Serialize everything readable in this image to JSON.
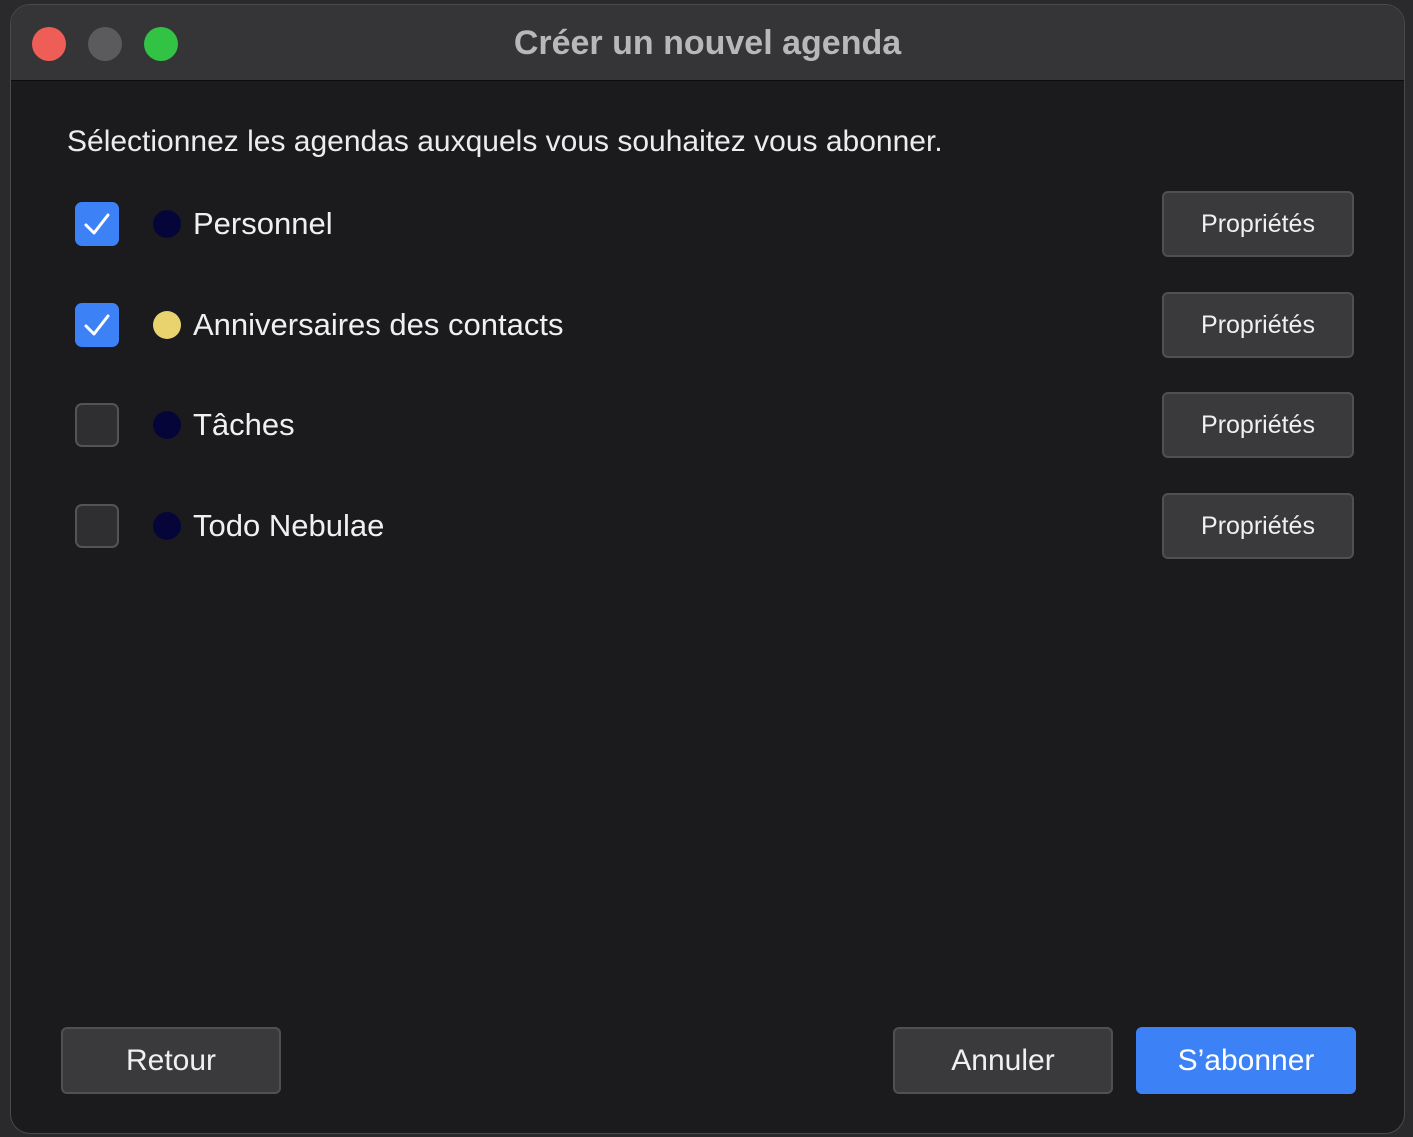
{
  "window": {
    "title": "Créer un nouvel agenda"
  },
  "instruction": "Sélectionnez les agendas auxquels vous souhaitez vous abonner.",
  "calendars": [
    {
      "name": "Personnel",
      "checked": true,
      "color": "#05053a",
      "properties_label": "Propriétés"
    },
    {
      "name": "Anniversaires des contacts",
      "checked": true,
      "color": "#e8d36e",
      "properties_label": "Propriétés"
    },
    {
      "name": "Tâches",
      "checked": false,
      "color": "#05053a",
      "properties_label": "Propriétés"
    },
    {
      "name": "Todo Nebulae",
      "checked": false,
      "color": "#05053a",
      "properties_label": "Propriétés"
    }
  ],
  "footer": {
    "back_label": "Retour",
    "cancel_label": "Annuler",
    "subscribe_label": "S’abonner"
  },
  "colors": {
    "accent": "#3c82f6",
    "close": "#ee5e57",
    "maximize": "#32c244"
  }
}
